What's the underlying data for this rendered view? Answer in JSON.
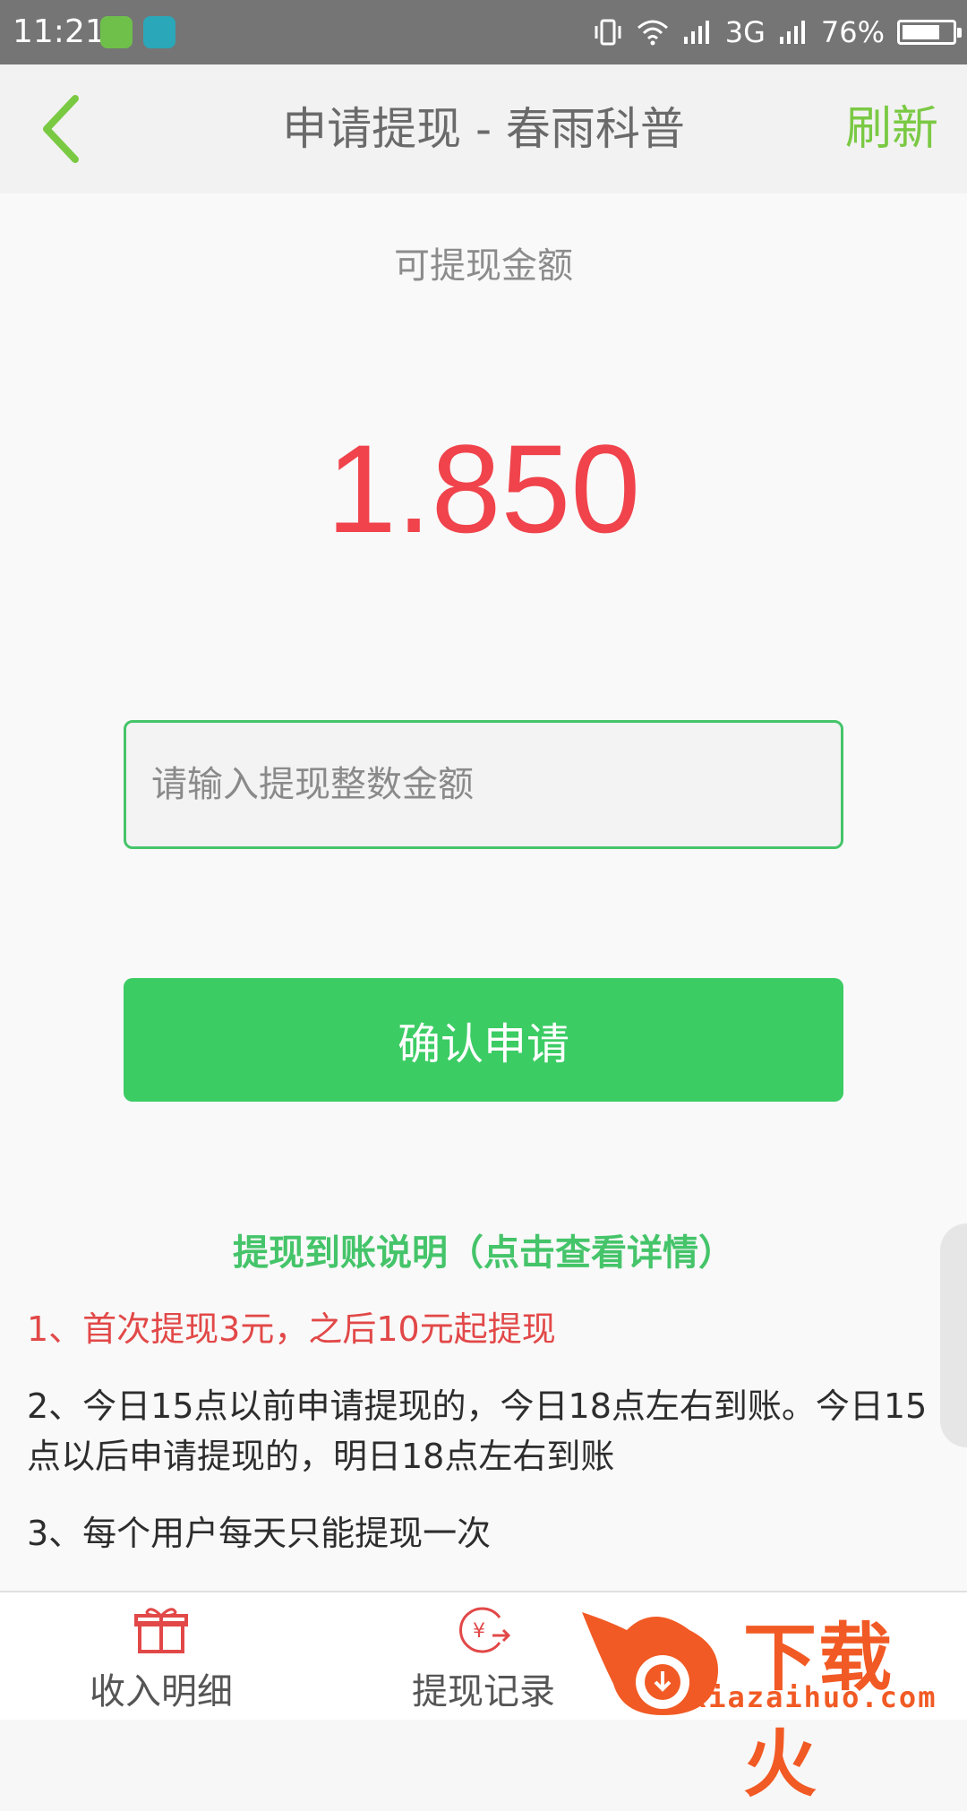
{
  "status_bar": {
    "time": "11:21",
    "network": "3G",
    "battery": "76%",
    "battery_level": 0.76
  },
  "header": {
    "title": "申请提现 - 春雨科普",
    "refresh_label": "刷新"
  },
  "balance": {
    "label": "可提现金额",
    "amount": "1.850"
  },
  "form": {
    "amount_placeholder": "请输入提现整数金额",
    "amount_value": "",
    "confirm_label": "确认申请"
  },
  "notes": {
    "title": "提现到账说明（点击查看详情）",
    "items": [
      "1、首次提现3元，之后10元起提现",
      "2、今日15点以前申请提现的，今日18点左右到账。今日15点以后申请提现的，明日18点左右到账",
      "3、每个用户每天只能提现一次"
    ]
  },
  "tabbar": {
    "income_label": "收入明细",
    "withdraw_label": "提现记录"
  },
  "watermark": {
    "brand": "下载火",
    "url": "xiazaihuo.com"
  },
  "colors": {
    "accent_green": "#3ccc64",
    "amount_red": "#f0434b",
    "refresh_green": "#7ac943",
    "note_red": "#e24848",
    "watermark_orange": "#f15a24"
  },
  "icons": {
    "back": "chevron-left-icon",
    "income": "gift-icon",
    "withdraw": "yuan-transfer-icon"
  }
}
